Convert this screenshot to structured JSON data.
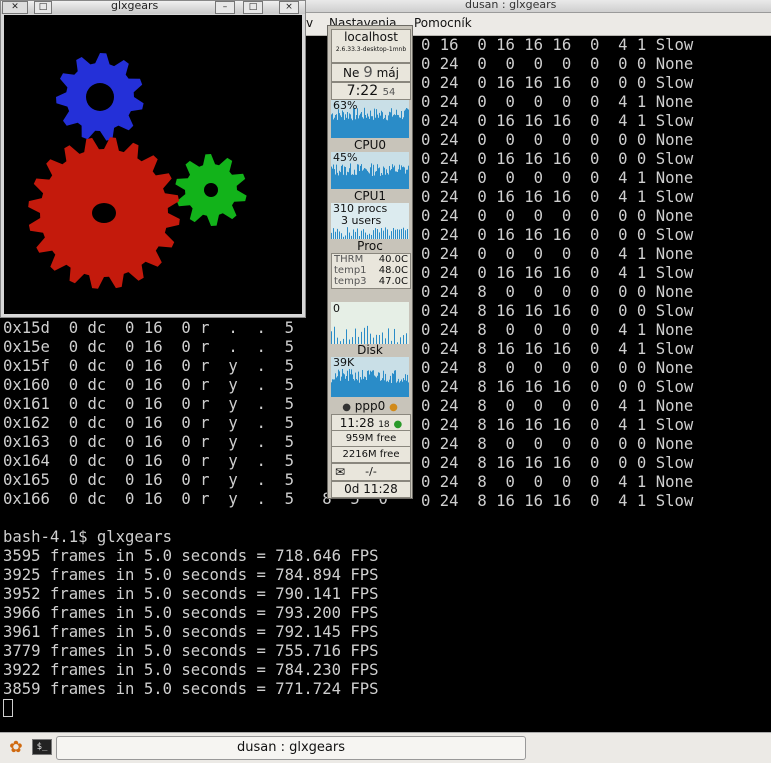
{
  "terminal": {
    "title": "dusan : glxgears",
    "menus": [
      "v",
      "Nastavenia",
      "Pomocník"
    ],
    "table_right_rows": [
      "0 16  0 16 16 16  0  4 1 Slow",
      "0 24  0  0  0  0  0  0 0 None",
      "0 24  0 16 16 16  0  0 0 Slow",
      "0 24  0  0  0  0  0  4 1 None",
      "0 24  0 16 16 16  0  4 1 Slow",
      "0 24  0  0  0  0  0  0 0 None",
      "0 24  0 16 16 16  0  0 0 Slow",
      "0 24  0  0  0  0  0  4 1 None",
      "0 24  0 16 16 16  0  4 1 Slow",
      "0 24  0  0  0  0  0  0 0 None",
      "0 24  0 16 16 16  0  0 0 Slow",
      "0 24  0  0  0  0  0  4 1 None",
      "0 24  0 16 16 16  0  4 1 Slow",
      "0 24  8  0  0  0  0  0 0 None",
      "0 24  8 16 16 16  0  0 0 Slow",
      "0 24  8  0  0  0  0  4 1 None",
      "0 24  8 16 16 16  0  4 1 Slow",
      "0 24  8  0  0  0  0  0 0 None",
      "0 24  8 16 16 16  0  0 0 Slow",
      "0 24  8  0  0  0  0  4 1 None",
      "0 24  8 16 16 16  0  4 1 Slow",
      "0 24  8  0  0  0  0  0 0 None",
      "0 24  8 16 16 16  0  0 0 Slow",
      "0 24  8  0  0  0  0  4 1 None",
      "0 24  8 16 16 16  0  4 1 Slow"
    ],
    "table_left_rows": [
      "0x15d  0 dc  0 16  0 r  .  .  5",
      "0x15e  0 dc  0 16  0 r  .  .  5",
      "0x15f  0 dc  0 16  0 r  y  .  5",
      "0x160  0 dc  0 16  0 r  y  .  5",
      "0x161  0 dc  0 16  0 r  y  .  5",
      "0x162  0 dc  0 16  0 r  y  .  5",
      "0x163  0 dc  0 16  0 r  y  .  5",
      "0x164  0 dc  0 16  0 r  y  .  5",
      "0x165  0 dc  0 16  0 r  y  .  5",
      "0x166  0 dc  0 16  0 r  y  .  5   8  5  0"
    ],
    "prompt": "bash-4.1$ glxgears",
    "fps_lines": [
      "3595 frames in 5.0 seconds = 718.646 FPS",
      "3925 frames in 5.0 seconds = 784.894 FPS",
      "3952 frames in 5.0 seconds = 790.141 FPS",
      "3966 frames in 5.0 seconds = 793.200 FPS",
      "3961 frames in 5.0 seconds = 792.145 FPS",
      "3779 frames in 5.0 seconds = 755.716 FPS",
      "3922 frames in 5.0 seconds = 784.230 FPS",
      "3859 frames in 5.0 seconds = 771.724 FPS"
    ]
  },
  "glxgears": {
    "title": "glxgears",
    "buttons": {
      "min": "–",
      "max": "□",
      "close": "×"
    },
    "colors": {
      "red": "#c41a0c",
      "green": "#12b31a",
      "blue": "#2430d8"
    }
  },
  "gkrellm": {
    "host": "localhost",
    "kernel": "2.6.33.3-desktop-1mnb",
    "day": "Ne",
    "date": "9",
    "month": "máj",
    "time": "7:22",
    "seconds": "54",
    "cpu_percent": "63%",
    "cpu0_label": "CPU0",
    "cpu0_percent": "45%",
    "cpu1_label": "CPU1",
    "procs": "310  procs",
    "users": "3  users",
    "proc_label": "Proc",
    "sensors": [
      {
        "name": "THRM",
        "value": "40.0C"
      },
      {
        "name": "temp1",
        "value": "48.0C"
      },
      {
        "name": "temp3",
        "value": "47.0C"
      }
    ],
    "disk_top_value": "0",
    "disk_label": "Disk",
    "disk_value": "39K",
    "net_label": "ppp0",
    "net_time": "11:28",
    "net_count": "18",
    "mem_free": "959M  free",
    "swap_free": "2216M free",
    "mail": "-/-",
    "uptime": "0d 11:28",
    "colors": {
      "chart_bg": "#c9dfe7",
      "chart_fill": "#2a8cc8",
      "chart_green": "#20b27a"
    }
  },
  "taskbar": {
    "task_label": "dusan : glxgears"
  }
}
